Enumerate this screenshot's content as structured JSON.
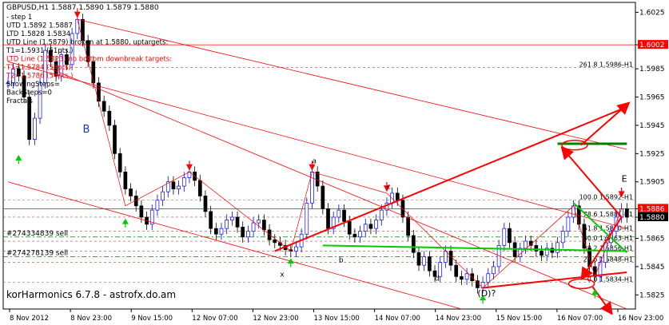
{
  "chart_data": {
    "type": "candlestick",
    "title": "GBPUSD,H1  1.5887 1.5890 1.5879 1.5880",
    "price_range": [
      1.5815,
      1.6032
    ],
    "y_ticks": [
      1.6025,
      1.6002,
      1.5985,
      1.5965,
      1.5945,
      1.5925,
      1.5905,
      1.5886,
      1.588,
      1.5865,
      1.5845,
      1.5825
    ],
    "highlighted_ticks": {
      "1.6002": "#ff0000",
      "1.5886": "#ff0000",
      "1.5880": "#000000"
    },
    "x_labels": [
      "8 Nov 2012",
      "8 Nov 23:00",
      "9 Nov 15:00",
      "12 Nov 07:00",
      "12 Nov 23:00",
      "13 Nov 15:00",
      "14 Nov 07:00",
      "14 Nov 23:00",
      "15 Nov 15:00",
      "16 Nov 07:00",
      "16 Nov 23:00"
    ],
    "info_lines": [
      "- step 1",
      "UTD 1.5892  1.5887",
      "LTD 1.5828  1.5834",
      "UTD Line (1.5879) broken at 1.5880, uptargets:",
      "T1=1.5931 (51pts.)",
      "LTD Line (1.5823) no bottom downbreak targets:",
      "T1=1.5784 (54pts)",
      "T2=1.5786 (54pts.)",
      "ShowingSteps=",
      "BackSteps=0",
      "Fractals"
    ],
    "fib_levels": [
      {
        "label": "261.8  1.5986-H1",
        "price": 1.5986
      },
      {
        "label": "100.0  1.5892-H1",
        "price": 1.5892
      },
      {
        "label": "78.6  1.5880-H1",
        "price": 1.588
      },
      {
        "label": "61.8  1.5870-H1",
        "price": 1.587
      },
      {
        "label": "50.0  1.5863-H1",
        "price": 1.5863
      },
      {
        "label": "38.2  1.5856-H1",
        "price": 1.5856
      },
      {
        "label": "23.6  1.5848-H1",
        "price": 1.5848
      },
      {
        "label": "0.0  1.5834-H1",
        "price": 1.5834
      }
    ],
    "wave_labels": [
      "B",
      "a",
      "c",
      "E",
      "x",
      "b",
      "d",
      "(D)?"
    ],
    "tickets": [
      "#274334839 sell",
      "#274278139 sell"
    ],
    "watermark": "korHarmonics 6.7.8 - astrofx.do.am",
    "colors": {
      "up": "#0000ff",
      "down": "#000000",
      "accent": "#ff0000",
      "green": "#00cc00",
      "darkgreen": "#008000"
    },
    "series": [
      {
        "values": [
          1.5975,
          1.5985,
          1.598,
          1.5965,
          1.5935,
          1.595,
          1.5975,
          1.5998,
          1.599,
          1.598,
          1.5995,
          1.5988,
          1.601,
          1.602,
          1.6005,
          1.599,
          1.5975,
          1.5962,
          1.5955,
          1.5945,
          1.5925,
          1.5912,
          1.59,
          1.5895,
          1.5888,
          1.588,
          1.5875,
          1.5885,
          1.5892,
          1.5898,
          1.5905,
          1.59,
          1.5902,
          1.5908,
          1.5912,
          1.5906,
          1.5895,
          1.5884,
          1.5872,
          1.5868,
          1.5872,
          1.5878,
          1.588,
          1.5873,
          1.5866,
          1.587,
          1.5876,
          1.5878,
          1.5871,
          1.5864,
          1.5862,
          1.586,
          1.5857,
          1.5856,
          1.5859,
          1.5868,
          1.589,
          1.5912,
          1.5902,
          1.5886,
          1.5872,
          1.588,
          1.5885,
          1.5877,
          1.5868,
          1.5866,
          1.587,
          1.5875,
          1.5872,
          1.5878,
          1.5885,
          1.589,
          1.5897,
          1.5892,
          1.588,
          1.5867,
          1.5855,
          1.5846,
          1.5852,
          1.5842,
          1.5838,
          1.5848,
          1.5856,
          1.5846,
          1.5838,
          1.5836,
          1.584,
          1.5835,
          1.583,
          1.5834,
          1.584,
          1.5845,
          1.586,
          1.5872,
          1.5862,
          1.5852,
          1.5858,
          1.5863,
          1.586,
          1.5856,
          1.5853,
          1.5858,
          1.5855,
          1.5862,
          1.587,
          1.588,
          1.5888,
          1.5875,
          1.5858,
          1.5845,
          1.5838,
          1.5848,
          1.5862,
          1.587,
          1.588,
          1.5886,
          1.588
        ]
      }
    ]
  }
}
